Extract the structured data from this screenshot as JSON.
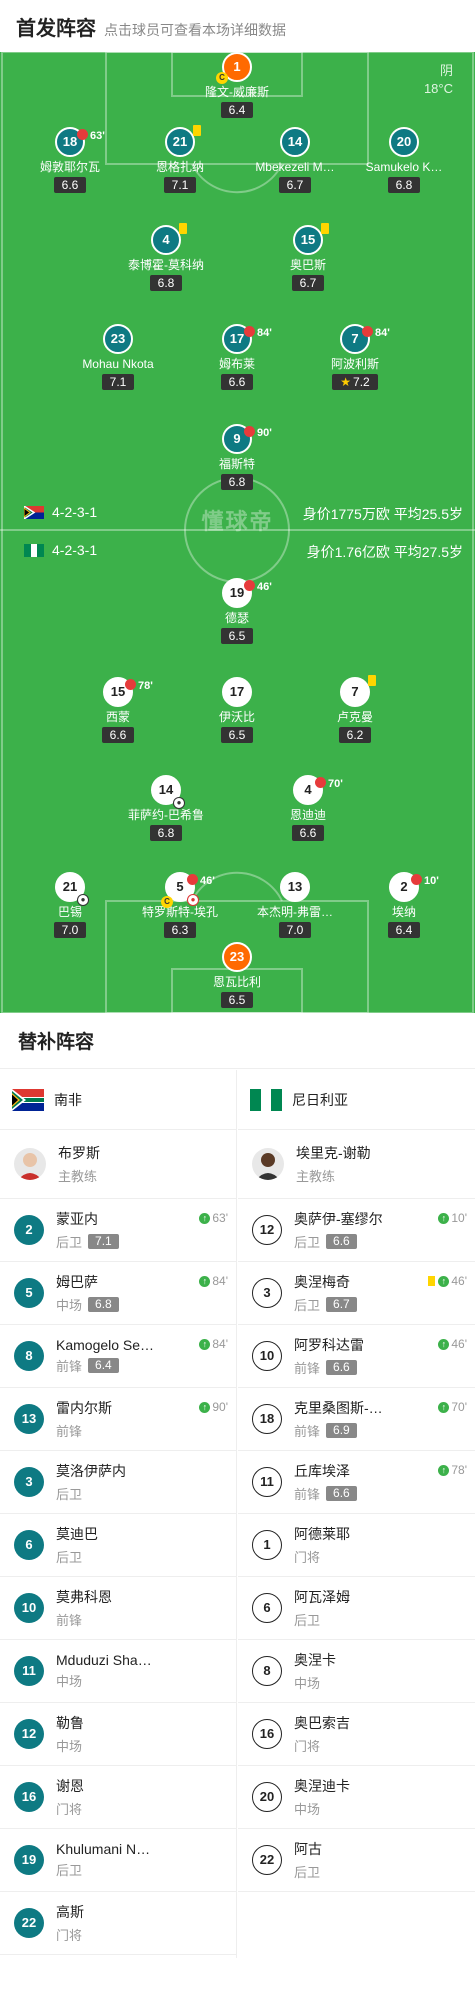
{
  "header": {
    "title": "首发阵容",
    "subtitle": "点击球员可查看本场详细数据"
  },
  "weather": {
    "condition": "阴",
    "temperature": "18°C"
  },
  "watermark": "懂球帝",
  "home": {
    "formation": "4-2-3-1",
    "value": "身价1775万欧  平均25.5岁"
  },
  "away": {
    "formation": "4-2-3-1",
    "value": "身价1.76亿欧  平均27.5岁"
  },
  "home_players": [
    {
      "num": "1",
      "name": "隆文-威廉斯",
      "rating": "6.4"
    },
    {
      "num": "18",
      "name": "姆敦耶尔瓦",
      "rating": "6.6",
      "event": "63'"
    },
    {
      "num": "21",
      "name": "恩格扎纳",
      "rating": "7.1"
    },
    {
      "num": "14",
      "name": "Mbekezeli M…",
      "rating": "6.7"
    },
    {
      "num": "20",
      "name": "Samukelo K…",
      "rating": "6.8"
    },
    {
      "num": "4",
      "name": "泰博霍-莫科纳",
      "rating": "6.8"
    },
    {
      "num": "15",
      "name": "奥巴斯",
      "rating": "6.7"
    },
    {
      "num": "23",
      "name": "Mohau Nkota",
      "rating": "7.1"
    },
    {
      "num": "17",
      "name": "姆布莱",
      "rating": "6.6",
      "event": "84'"
    },
    {
      "num": "7",
      "name": "阿波利斯",
      "rating": "7.2",
      "event": "84'"
    },
    {
      "num": "9",
      "name": "福斯特",
      "rating": "6.8",
      "event": "90'"
    }
  ],
  "away_players": [
    {
      "num": "19",
      "name": "德瑟",
      "rating": "6.5",
      "event": "46'"
    },
    {
      "num": "15",
      "name": "西蒙",
      "rating": "6.6",
      "event": "78'"
    },
    {
      "num": "17",
      "name": "伊沃比",
      "rating": "6.5"
    },
    {
      "num": "7",
      "name": "卢克曼",
      "rating": "6.2"
    },
    {
      "num": "14",
      "name": "菲萨约-巴希鲁",
      "rating": "6.8"
    },
    {
      "num": "4",
      "name": "恩迪迪",
      "rating": "6.6",
      "event": "70'"
    },
    {
      "num": "21",
      "name": "巴锡",
      "rating": "7.0"
    },
    {
      "num": "5",
      "name": "特罗斯特-埃孔",
      "rating": "6.3",
      "event": "46'"
    },
    {
      "num": "13",
      "name": "本杰明-弗雷…",
      "rating": "7.0"
    },
    {
      "num": "2",
      "name": "埃纳",
      "rating": "6.4",
      "event": "10'"
    },
    {
      "num": "23",
      "name": "恩瓦比利",
      "rating": "6.5"
    }
  ],
  "subs_title": "替补阵容",
  "left": {
    "team": "南非",
    "coach": {
      "name": "布罗斯",
      "role": "主教练"
    },
    "players": [
      {
        "num": "2",
        "name": "蒙亚内",
        "pos": "后卫",
        "rating": "7.1",
        "in": "63'"
      },
      {
        "num": "5",
        "name": "姆巴萨",
        "pos": "中场",
        "rating": "6.8",
        "in": "84'"
      },
      {
        "num": "8",
        "name": "Kamogelo Se…",
        "pos": "前锋",
        "rating": "6.4",
        "in": "84'"
      },
      {
        "num": "13",
        "name": "雷内尔斯",
        "pos": "前锋",
        "in": "90'"
      },
      {
        "num": "3",
        "name": "莫洛伊萨内",
        "pos": "后卫"
      },
      {
        "num": "6",
        "name": "莫迪巴",
        "pos": "后卫"
      },
      {
        "num": "10",
        "name": "莫弗科恩",
        "pos": "前锋"
      },
      {
        "num": "11",
        "name": "Mduduzi Sha…",
        "pos": "中场"
      },
      {
        "num": "12",
        "name": "勒鲁",
        "pos": "中场"
      },
      {
        "num": "16",
        "name": "谢恩",
        "pos": "门将"
      },
      {
        "num": "19",
        "name": "Khulumani N…",
        "pos": "后卫"
      },
      {
        "num": "22",
        "name": "高斯",
        "pos": "门将"
      }
    ]
  },
  "right": {
    "team": "尼日利亚",
    "coach": {
      "name": "埃里克-谢勒",
      "role": "主教练"
    },
    "players": [
      {
        "num": "12",
        "name": "奥萨伊-塞缪尔",
        "pos": "后卫",
        "rating": "6.6",
        "in": "10'"
      },
      {
        "num": "3",
        "name": "奥涅梅奇",
        "pos": "后卫",
        "rating": "6.7",
        "in": "46'"
      },
      {
        "num": "10",
        "name": "阿罗科达雷",
        "pos": "前锋",
        "rating": "6.6",
        "in": "46'"
      },
      {
        "num": "18",
        "name": "克里桑图斯-…",
        "pos": "前锋",
        "rating": "6.9",
        "in": "70'"
      },
      {
        "num": "11",
        "name": "丘库埃泽",
        "pos": "前锋",
        "rating": "6.6",
        "in": "78'"
      },
      {
        "num": "1",
        "name": "阿德莱耶",
        "pos": "门将"
      },
      {
        "num": "6",
        "name": "阿瓦泽姆",
        "pos": "后卫"
      },
      {
        "num": "8",
        "name": "奥涅卡",
        "pos": "中场"
      },
      {
        "num": "16",
        "name": "奥巴索吉",
        "pos": "门将"
      },
      {
        "num": "20",
        "name": "奥涅迪卡",
        "pos": "中场"
      },
      {
        "num": "22",
        "name": "阿古",
        "pos": "后卫"
      }
    ]
  }
}
